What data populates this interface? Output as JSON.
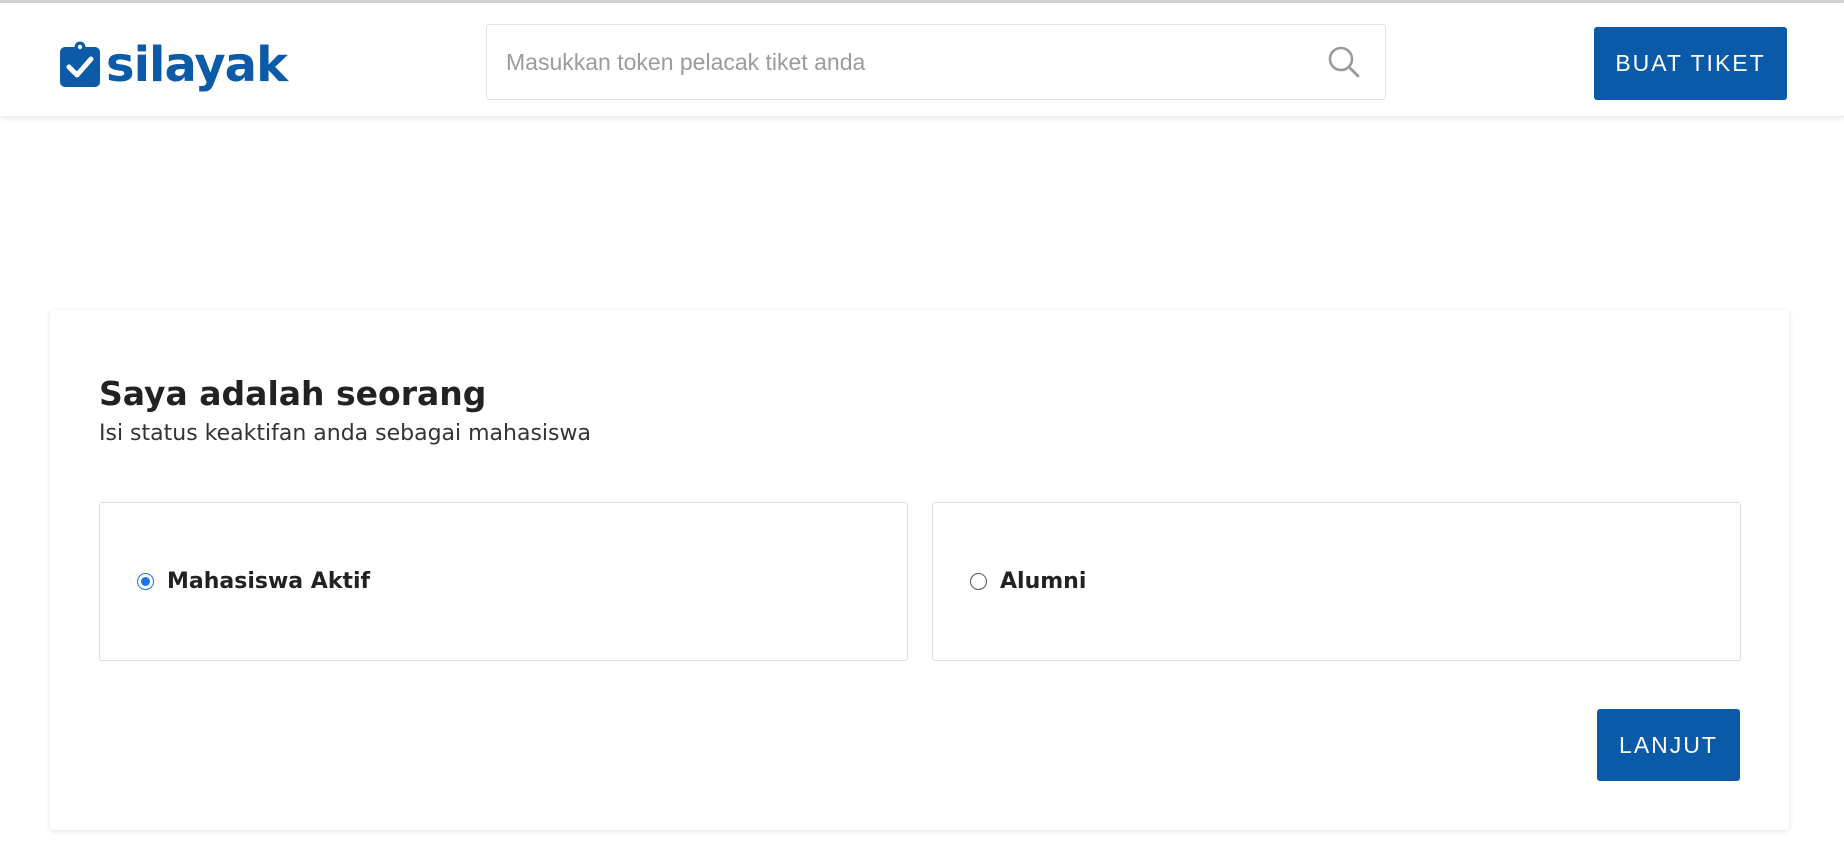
{
  "brand": {
    "name": "silayak",
    "color": "#0b5ba8",
    "icon": "clipboard-check-icon"
  },
  "search": {
    "placeholder": "Masukkan token pelacak tiket anda",
    "value": "",
    "icon": "search-icon"
  },
  "header": {
    "create_ticket_label": "BUAT TIKET"
  },
  "form": {
    "title": "Saya adalah seorang",
    "subtitle": "Isi status keaktifan anda sebagai mahasiswa",
    "options": [
      {
        "label": "Mahasiswa Aktif",
        "selected": true
      },
      {
        "label": "Alumni",
        "selected": false
      }
    ],
    "next_label": "LANJUT"
  },
  "colors": {
    "primary": "#0a5aa8",
    "radio_checked": "#1a73e8"
  }
}
